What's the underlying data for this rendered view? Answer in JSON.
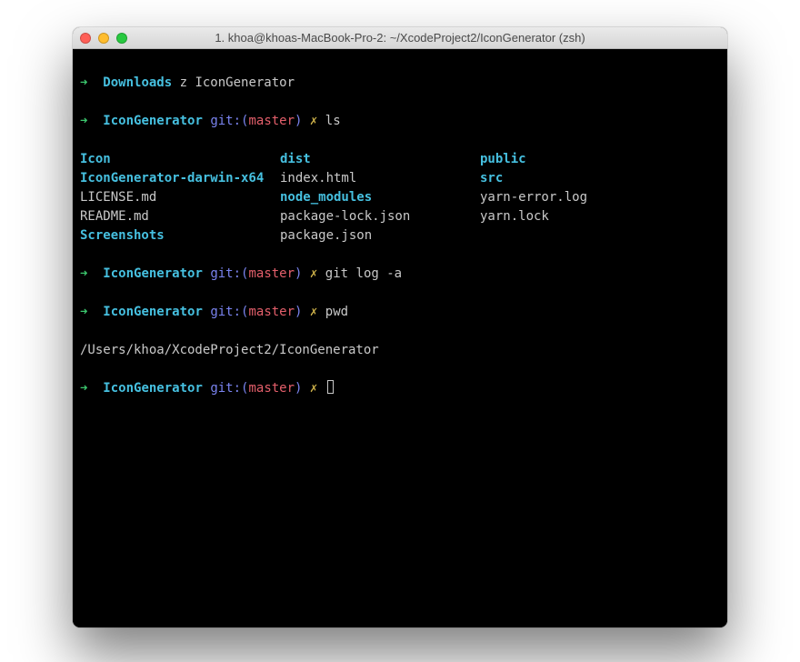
{
  "window": {
    "title": "1. khoa@khoas-MacBook-Pro-2: ~/XcodeProject2/IconGenerator (zsh)"
  },
  "prompt": {
    "arrow": "➜",
    "gitLabel": "git:",
    "parenOpen": "(",
    "parenClose": ")",
    "branch": "master",
    "dirty": "✗"
  },
  "lines": {
    "l1_dir": "Downloads",
    "l1_cmd": "z IconGenerator",
    "l2_dir": "IconGenerator",
    "l2_cmd": "ls",
    "ls": {
      "col1": [
        {
          "name": "Icon",
          "type": "dir"
        },
        {
          "name": "IconGenerator-darwin-x64",
          "type": "dir"
        },
        {
          "name": "LICENSE.md",
          "type": "file"
        },
        {
          "name": "README.md",
          "type": "file"
        },
        {
          "name": "Screenshots",
          "type": "dir"
        }
      ],
      "col2": [
        {
          "name": "dist",
          "type": "dir"
        },
        {
          "name": "index.html",
          "type": "file"
        },
        {
          "name": "node_modules",
          "type": "dir"
        },
        {
          "name": "package-lock.json",
          "type": "file"
        },
        {
          "name": "package.json",
          "type": "file"
        }
      ],
      "col3": [
        {
          "name": "public",
          "type": "dir"
        },
        {
          "name": "src",
          "type": "dir"
        },
        {
          "name": "yarn-error.log",
          "type": "file"
        },
        {
          "name": "yarn.lock",
          "type": "file"
        }
      ]
    },
    "l3_dir": "IconGenerator",
    "l3_cmd": "git log -a",
    "l4_dir": "IconGenerator",
    "l4_cmd": "pwd",
    "pwd_out": "/Users/khoa/XcodeProject2/IconGenerator",
    "l5_dir": "IconGenerator"
  }
}
